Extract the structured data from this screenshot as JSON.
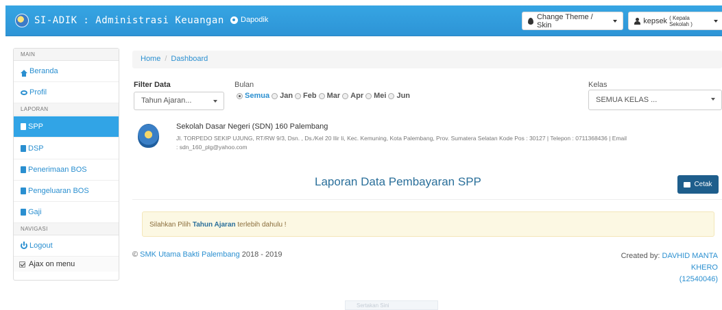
{
  "topbar": {
    "title": "SI-ADIK : Administrasi Keuangan",
    "dapodik_label": "Dapodik",
    "theme_button": "Change Theme / Skin",
    "user_name": "kepsek",
    "user_role": "( Kepala Sekolah )"
  },
  "sidebar": {
    "main_header": "MAIN",
    "beranda": "Beranda",
    "profil": "Profil",
    "laporan_header": "LAPORAN",
    "spp": "SPP",
    "dsp": "DSP",
    "penerimaan_bos": "Penerimaan BOS",
    "pengeluaran_bos": "Pengeluaran BOS",
    "gaji": "Gaji",
    "navigasi_header": "NAVIGASI",
    "logout": "Logout",
    "ajax_label": "Ajax on menu"
  },
  "breadcrumb": {
    "home": "Home",
    "sep": "/",
    "current": "Dashboard"
  },
  "filter": {
    "label": "Filter Data",
    "tahun_value": "Tahun Ajaran...",
    "bulan_label": "Bulan",
    "bulan_options": [
      "Semua",
      "Jan",
      "Feb",
      "Mar",
      "Apr",
      "Mei",
      "Jun"
    ],
    "bulan_selected": "Semua",
    "kelas_label": "Kelas",
    "kelas_value": "SEMUA KELAS ..."
  },
  "school": {
    "name": "Sekolah Dasar Negeri (SDN) 160 Palembang",
    "address": "Jl. TORPEDO SEKIP UJUNG, RT/RW 9/3, Dsn. , Ds./Kel 20 Ilir Ii, Kec. Kemuning, Kota Palembang, Prov. Sumatera Selatan Kode Pos : 30127 | Telepon : 0711368436 | Email : sdn_160_plg@yahoo.com"
  },
  "report": {
    "title": "Laporan Data Pembayaran SPP",
    "print_button": "Cetak"
  },
  "alert": {
    "prefix": "Silahkan Pilih",
    "emphasis": "Tahun Ajaran",
    "suffix": "terlebih dahulu !"
  },
  "footer": {
    "copyright_symbol": "©",
    "school_link": "SMK Utama Bakti Palembang",
    "years": "2018 - 2019",
    "created_by": "Created by:",
    "author": "DAVHID MANTA KHERO",
    "author_id": "(12540046)"
  },
  "ghost_text": "Sertakan Sini"
}
